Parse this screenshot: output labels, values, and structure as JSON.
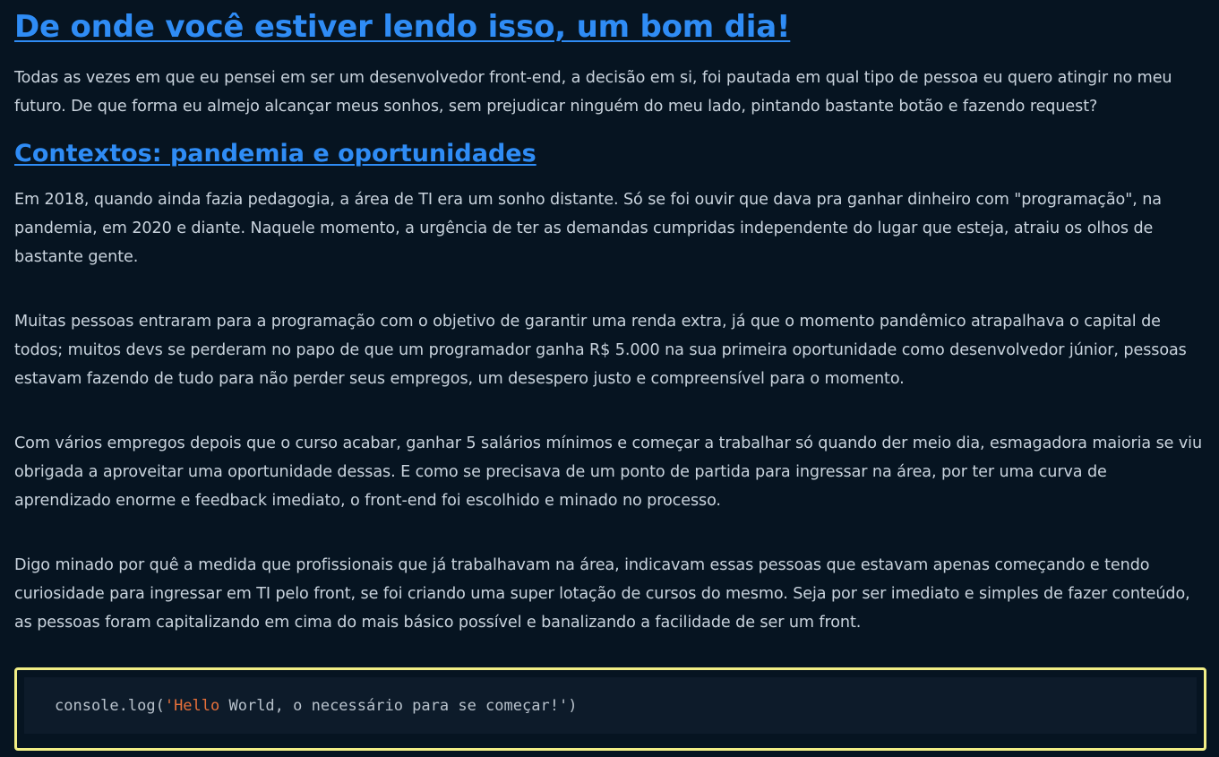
{
  "article": {
    "title": "De onde você estiver lendo isso, um bom dia!",
    "intro": "Todas as vezes em que eu pensei em ser um desenvolvedor front-end, a decisão em si, foi pautada em qual tipo de pessoa eu quero atingir no meu futuro. De que forma eu almejo alcançar meus sonhos, sem prejudicar ninguém do meu lado, pintando bastante botão e fazendo request?",
    "section_heading": "Contextos: pandemia e oportunidades",
    "paragraphs": [
      "Em 2018, quando ainda fazia pedagogia, a área de TI era um sonho distante. Só se foi ouvir que dava pra ganhar dinheiro com \"programação\", na pandemia, em 2020 e diante. Naquele momento, a urgência de ter as demandas cumpridas independente do lugar que esteja, atraiu os olhos de bastante gente.",
      "Muitas pessoas entraram para a programação com o objetivo de garantir uma renda extra, já que o momento pandêmico atrapalhava o capital de todos; muitos devs se perderam no papo de que um programador ganha R$ 5.000 na sua primeira oportunidade como desenvolvedor júnior, pessoas estavam fazendo de tudo para não perder seus empregos, um desespero justo e compreensível para o momento.",
      "Com vários empregos depois que o curso acabar, ganhar 5 salários mínimos e começar a trabalhar só quando der meio dia, esmagadora maioria se viu obrigada a aproveitar uma oportunidade dessas. E como se precisava de um ponto de partida para ingressar na área, por ter uma curva de aprendizado enorme e feedback imediato, o front-end foi escolhido e minado no processo.",
      "Digo minado por quê a medida que profissionais que já trabalhavam na área, indicavam essas pessoas que estavam apenas começando e tendo curiosidade para ingressar em TI pelo front, se foi criando uma super lotação de cursos do mesmo. Seja por ser imediato e simples de fazer conteúdo, as pessoas foram capitalizando em cima do mais básico possível e banalizando a facilidade de ser um front."
    ],
    "code": {
      "prefix": "console.log(",
      "string_highlight": "'Hello",
      "string_rest": " World, o necessário para se começar!'",
      "suffix": ")"
    }
  },
  "colors": {
    "background": "#061421",
    "heading": "#2f8cf5",
    "text": "#c9d3dd",
    "code_background": "#0d1b2a",
    "code_string": "#e8703a",
    "highlight_border": "#f1ee86"
  }
}
